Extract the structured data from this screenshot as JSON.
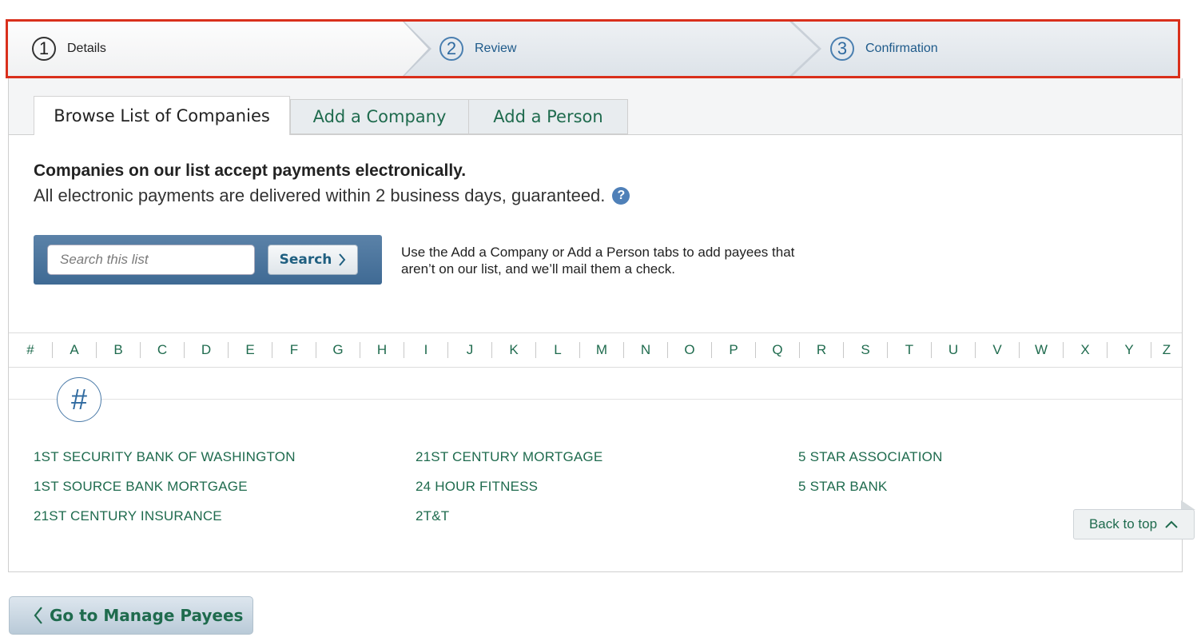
{
  "steps": [
    {
      "number": "1",
      "label": "Details"
    },
    {
      "number": "2",
      "label": "Review"
    },
    {
      "number": "3",
      "label": "Confirmation"
    }
  ],
  "tabs": {
    "browse": "Browse List of Companies",
    "add_company": "Add a Company",
    "add_person": "Add a Person"
  },
  "intro": {
    "heading": "Companies on our list accept payments electronically.",
    "subtext": "All electronic payments are delivered within 2 business days, guaranteed.",
    "help_icon": "?"
  },
  "search": {
    "placeholder": "Search this list",
    "value": "",
    "button_label": "Search",
    "note": "Use the Add a Company or Add a Person tabs to add payees that aren’t on our list, and we’ll mail them a check."
  },
  "alphabet": [
    "#",
    "A",
    "B",
    "C",
    "D",
    "E",
    "F",
    "G",
    "H",
    "I",
    "J",
    "K",
    "L",
    "M",
    "N",
    "O",
    "P",
    "Q",
    "R",
    "S",
    "T",
    "U",
    "V",
    "W",
    "X",
    "Y",
    "Z"
  ],
  "section": {
    "heading": "#",
    "companies": [
      [
        "1ST SECURITY BANK OF WASHINGTON",
        "1ST SOURCE BANK MORTGAGE",
        "21ST CENTURY INSURANCE"
      ],
      [
        "21ST CENTURY MORTGAGE",
        "24 HOUR FITNESS",
        "2T&T"
      ],
      [
        "5 STAR ASSOCIATION",
        "5 STAR BANK"
      ]
    ]
  },
  "back_to_top": "Back to top",
  "manage_payees": "Go to Manage Payees",
  "colors": {
    "accent_green": "#1f6b4e",
    "step_blue": "#1e5a8a",
    "highlight_red": "#d9301c",
    "search_blue": "#3f6a94"
  },
  "icons": [
    "help-icon",
    "chevron-right-icon",
    "chevron-up-icon",
    "chevron-left-icon"
  ]
}
